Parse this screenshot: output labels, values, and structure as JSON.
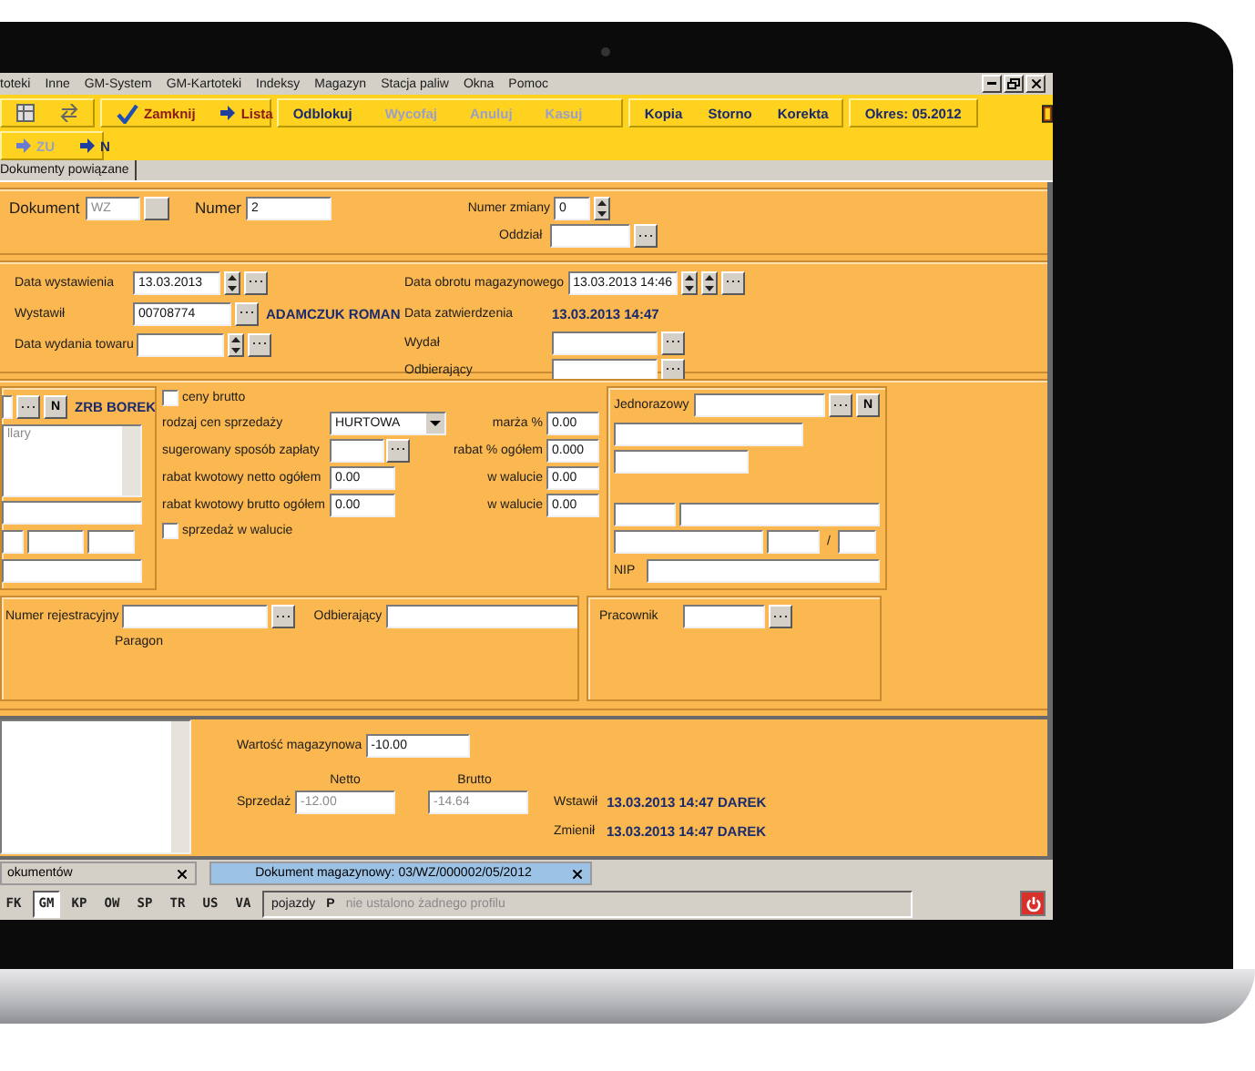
{
  "menu": [
    "toteki",
    "Inne",
    "GM-System",
    "GM-Kartoteki",
    "Indeksy",
    "Magazyn",
    "Stacja paliw",
    "Okna",
    "Pomoc"
  ],
  "toolbar": {
    "groups": [
      [
        {
          "label": "Zamknij",
          "kind": "check",
          "disabled": false
        },
        {
          "label": "Lista",
          "kind": "arrow",
          "disabled": false
        }
      ],
      [
        {
          "label": "Odblokuj",
          "kind": "text",
          "disabled": false
        },
        {
          "label": "Wycofaj",
          "kind": "text",
          "disabled": true
        },
        {
          "label": "Anuluj",
          "kind": "text",
          "disabled": true
        },
        {
          "label": "Kasuj",
          "kind": "text",
          "disabled": true
        }
      ],
      [
        {
          "label": "Kopia",
          "kind": "text",
          "disabled": false
        },
        {
          "label": "Storno",
          "kind": "text",
          "disabled": false
        },
        {
          "label": "Korekta",
          "kind": "text",
          "disabled": false
        }
      ]
    ],
    "period": "Okres:  05.2012",
    "row2": [
      {
        "label": "ZU",
        "disabled": true
      },
      {
        "label": "N",
        "disabled": false
      }
    ]
  },
  "tabs": [
    {
      "label": "Dokumenty powiązane",
      "selected": true
    }
  ],
  "header": {
    "dokument_label": "Dokument",
    "dokument_value": "WZ",
    "numer_label": "Numer",
    "numer_value": "2",
    "numer_zmiany_label": "Numer zmiany",
    "numer_zmiany_value": "0",
    "oddzial_label": "Oddział"
  },
  "dates_left": [
    {
      "kind": "date",
      "label": "Data wystawienia",
      "value": "13.03.2013"
    },
    {
      "kind": "lookup",
      "label": "Wystawił",
      "value": "00708774",
      "extra": "ADAMCZUK ROMAN"
    },
    {
      "kind": "date",
      "label": "Data wydania towaru"
    }
  ],
  "dates_right": [
    {
      "kind": "datetime",
      "label": "Data obrotu magazynowego",
      "value": "13.03.2013 14:46"
    },
    {
      "kind": "info",
      "label": "Data zatwierdzenia",
      "value": "13.03.2013 14:47"
    },
    {
      "kind": "lookup",
      "label": "Wydał"
    },
    {
      "kind": "lookup",
      "label": "Odbierający"
    }
  ],
  "customer": {
    "button": "N",
    "name": "ZRB BOREK",
    "notes_placeholder": "llary"
  },
  "pricing": {
    "ceny_brutto": {
      "label": "ceny brutto",
      "checked": false
    },
    "rows": [
      {
        "kind": "select",
        "label": "rodzaj cen sprzedaży",
        "value": "HURTOWA",
        "right_label": "marża %",
        "right_value": "0.00"
      },
      {
        "kind": "lookup",
        "label": "sugerowany sposób zapłaty",
        "right_label": "rabat % ogółem",
        "right_value": "0.000"
      },
      {
        "kind": "text",
        "label": "rabat kwotowy netto ogółem",
        "value": "0.00",
        "right_label": "w walucie",
        "right_value": "0.00"
      },
      {
        "kind": "text",
        "label": "rabat kwotowy brutto ogółem",
        "value": "0.00",
        "right_label": "w walucie",
        "right_value": "0.00"
      }
    ],
    "waluta": {
      "label": "sprzedaż w walucie",
      "checked": false
    }
  },
  "one_time": {
    "label": "Jednorazowy",
    "button": "N",
    "slash": "/",
    "nip_label": "NIP"
  },
  "vehicle": {
    "numer_label": "Numer rejestracyjny",
    "odbierajacy_label": "Odbierający",
    "paragon": "Paragon",
    "pracownik_label": "Pracownik"
  },
  "totals": {
    "wartosc_label": "Wartość magazynowa",
    "wartosc_value": "-10.00",
    "netto": "Netto",
    "brutto": "Brutto",
    "sprzedaz_label": "Sprzedaż",
    "sprzedaz_netto": "-12.00",
    "sprzedaz_brutto": "-14.64",
    "audit": [
      {
        "label": "Wstawił",
        "value": "13.03.2013 14:47  DAREK"
      },
      {
        "label": "Zmienił",
        "value": "13.03.2013 14:47  DAREK"
      }
    ]
  },
  "doc_tabs": [
    {
      "label": "okumentów",
      "selected": false
    },
    {
      "label": "Dokument magazynowy: 03/WZ/000002/05/2012",
      "selected": true
    }
  ],
  "modules": [
    {
      "label": "FK",
      "selected": false
    },
    {
      "label": "GM",
      "selected": true
    },
    {
      "label": "KP",
      "selected": false
    },
    {
      "label": "OW",
      "selected": false
    },
    {
      "label": "SP",
      "selected": false
    },
    {
      "label": "TR",
      "selected": false
    },
    {
      "label": "US",
      "selected": false
    },
    {
      "label": "VA",
      "selected": false
    }
  ],
  "status": {
    "pojazdy": "pojazdy",
    "p": "P",
    "profile": "nie ustalono żadnego profilu"
  }
}
